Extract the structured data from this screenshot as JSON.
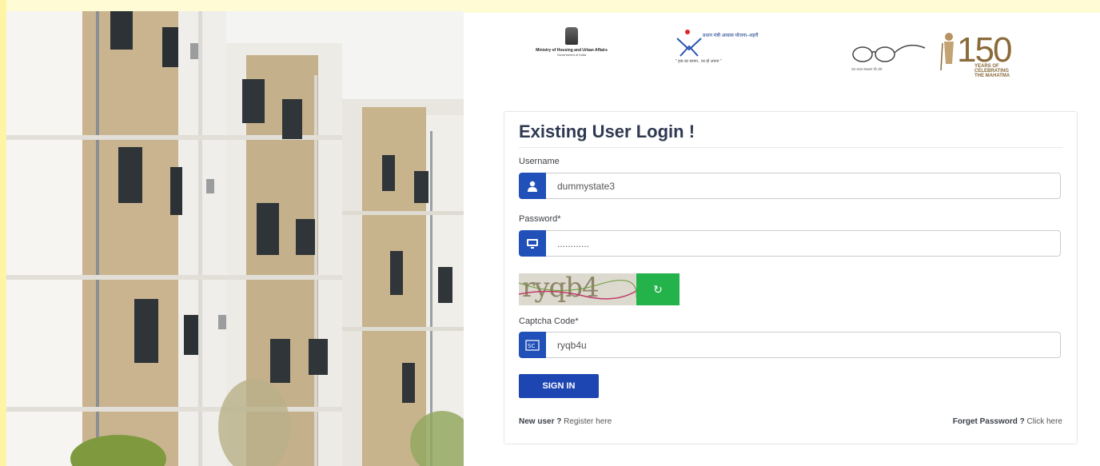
{
  "logos": {
    "mohua_name": "Ministry of Housing and Urban Affairs",
    "mohua_sub": "Government of India",
    "pmay_name_hindi": "प्रधान मंत्री आवास योजना–शहरी",
    "pmay_tagline": "\" हक का सपना.. घर हो अपना \"",
    "swachh_text": "एक कदम स्वच्छता की ओर",
    "gandhi_number": "150",
    "gandhi_text": "YEARS OF CELEBRATING THE MAHATMA"
  },
  "login": {
    "title": "Existing User Login !",
    "username_label": "Username",
    "username_value": "dummystate3",
    "password_label": "Password*",
    "password_value": "............",
    "captcha_image_text": "ryqb4",
    "captcha_label": "Captcha Code*",
    "captcha_value": "ryqb4u",
    "signin_label": "SIGN IN",
    "new_user_strong": "New user ?",
    "register_link": "Register here",
    "forget_strong": "Forget Password ?",
    "click_here_link": "Click here"
  },
  "colors": {
    "primary": "#1e46b3",
    "refresh": "#24b34a",
    "title": "#2f3a52"
  },
  "icons": {
    "username": "user-icon",
    "password": "monitor-icon",
    "captcha": "captcha-icon",
    "refresh": "refresh-icon"
  }
}
